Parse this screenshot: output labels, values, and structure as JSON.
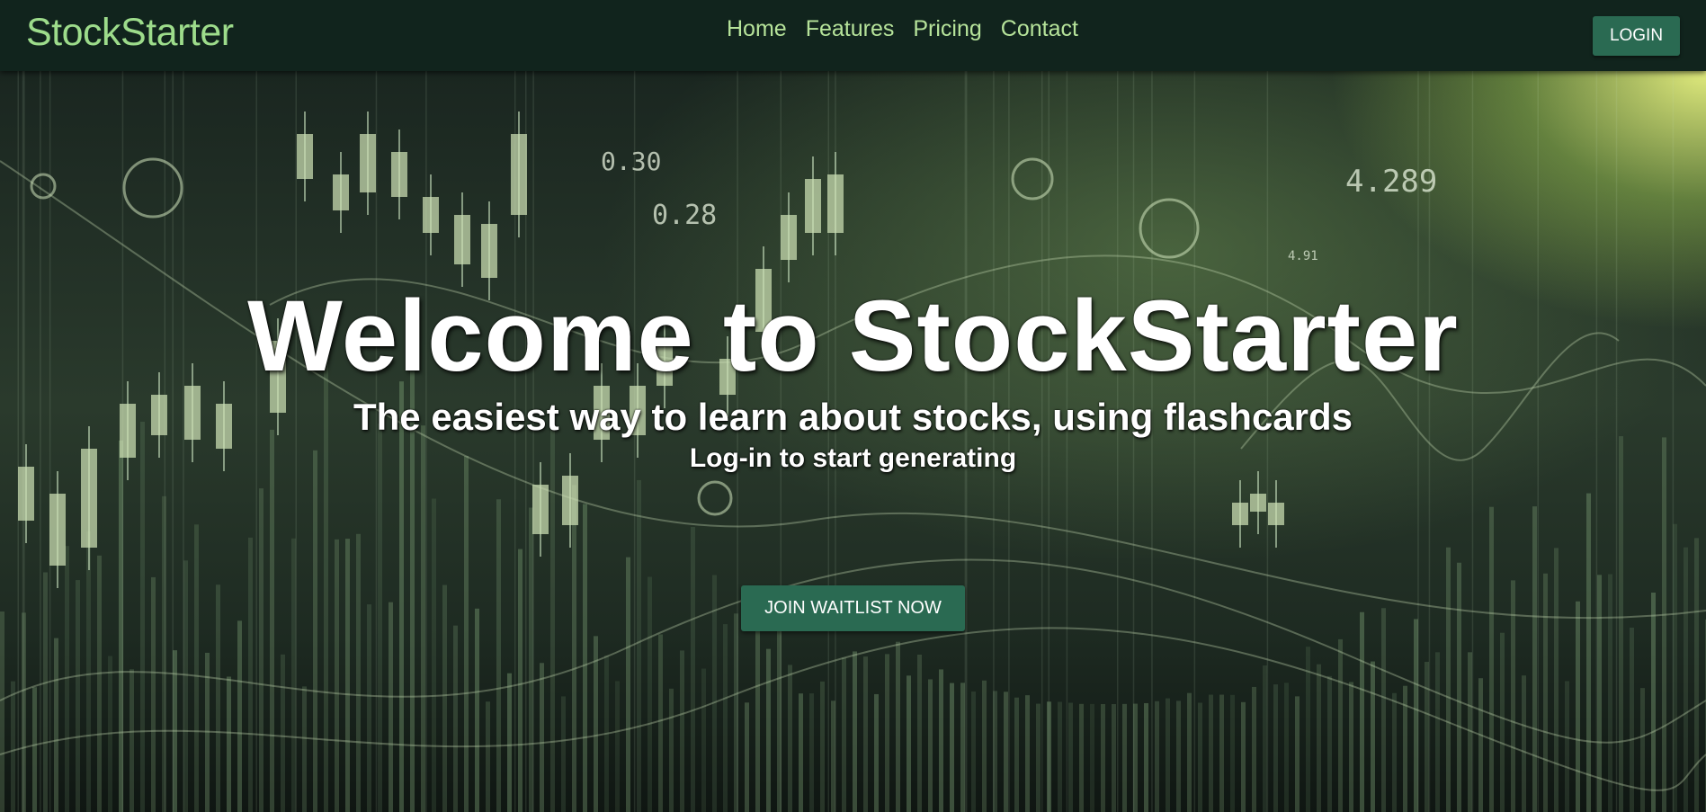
{
  "nav": {
    "brand": "StockStarter",
    "links": [
      "Home",
      "Features",
      "Pricing",
      "Contact"
    ],
    "login_label": "LOGIN"
  },
  "hero": {
    "title": "Welcome to StockStarter",
    "subtitle": "The easiest way to learn about stocks, using flashcards",
    "note": "Log-in to start generating",
    "cta_label": "JOIN WAITLIST NOW",
    "background_numbers": [
      "0.30",
      "0.28",
      "4.289",
      "4.91"
    ]
  },
  "colors": {
    "nav_bg": "#11241d",
    "brand": "#9ddc8b",
    "nav_link": "#b6e39a",
    "button_bg": "#2a6a52",
    "button_text": "#ffffff"
  }
}
